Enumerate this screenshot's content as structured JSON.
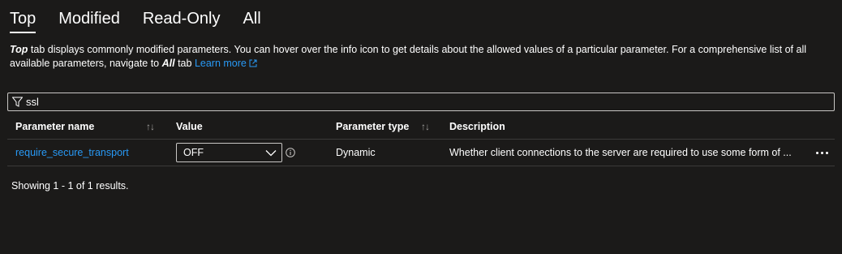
{
  "tabs": [
    {
      "label": "Top",
      "active": true
    },
    {
      "label": "Modified",
      "active": false
    },
    {
      "label": "Read-Only",
      "active": false
    },
    {
      "label": "All",
      "active": false
    }
  ],
  "description": {
    "top_word": "Top",
    "text1": " tab displays commonly modified parameters. You can hover over the info icon to get details about the allowed values of a particular parameter. For a comprehensive list of all available parameters, navigate to ",
    "all_word": "All",
    "text2": " tab ",
    "learn_more": "Learn more"
  },
  "filter": {
    "value": "ssl"
  },
  "table": {
    "headers": {
      "name": "Parameter name",
      "value": "Value",
      "type": "Parameter type",
      "description": "Description"
    },
    "rows": [
      {
        "name": "require_secure_transport",
        "value": "OFF",
        "type": "Dynamic",
        "description": "Whether client connections to the server are required to use some form of ..."
      }
    ]
  },
  "results_text": "Showing 1 - 1 of 1 results.",
  "colors": {
    "background": "#1b1a19",
    "link": "#2899f5",
    "border": "#c8c6c4"
  },
  "icons": [
    "filter-icon",
    "external-link-icon",
    "sort-icon",
    "chevron-down-icon",
    "info-icon",
    "more-icon"
  ]
}
